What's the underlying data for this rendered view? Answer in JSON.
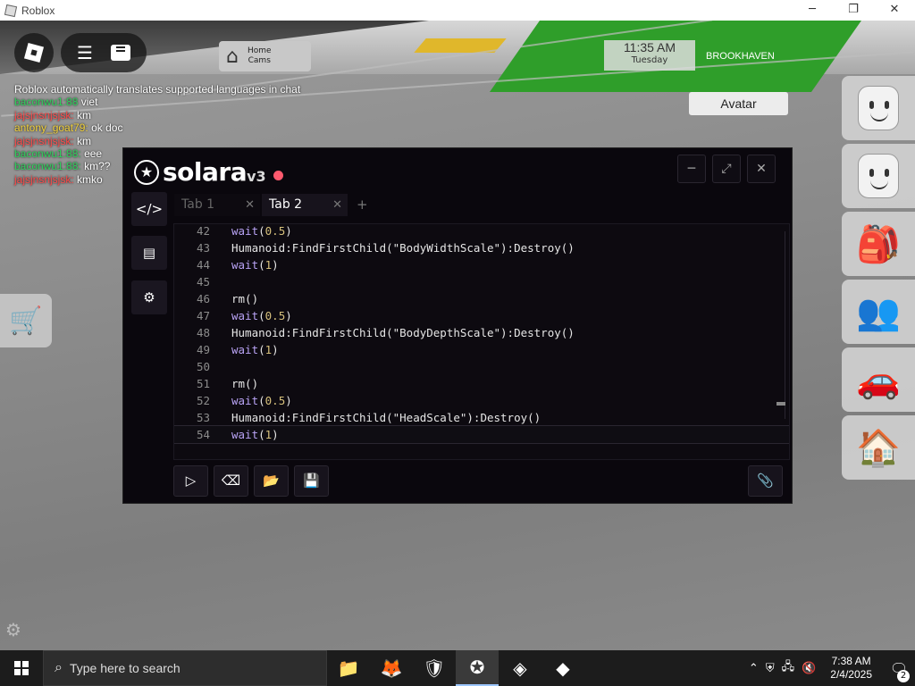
{
  "window": {
    "title": "Roblox",
    "minimize": "─",
    "maximize": "❐",
    "close": "✕"
  },
  "hud": {
    "home_cams_line1": "Home",
    "home_cams_line2": "Cams",
    "clock_time": "11:35 AM",
    "clock_day": "Tuesday",
    "place": "BROOKHAVEN",
    "avatar_label": "Avatar"
  },
  "chat": {
    "system": "Roblox automatically translates supported languages in chat",
    "messages": [
      {
        "name": "baconwu1:88",
        "text": " viet",
        "color": "#2fd15c"
      },
      {
        "name": "jajsjnsnjsjsk:",
        "text": " km",
        "color": "#ff4b4b"
      },
      {
        "name": "antony_goat79:",
        "text": " ok doc",
        "color": "#f2d13a"
      },
      {
        "name": "jajsjnsnjsjsk:",
        "text": " km",
        "color": "#ff4b4b"
      },
      {
        "name": "baconwu1:88:",
        "text": " eee",
        "color": "#2fd15c"
      },
      {
        "name": "baconwu1:88:",
        "text": " km??",
        "color": "#2fd15c"
      },
      {
        "name": "jajsjnsnjsjsk:",
        "text": " kmko",
        "color": "#ff4b4b"
      }
    ]
  },
  "solara": {
    "brand_name": "solara",
    "brand_version": "v3",
    "tabs": [
      {
        "label": "Tab 1"
      },
      {
        "label": "Tab 2"
      }
    ],
    "tab_add": "+",
    "tab_close": "✕",
    "controls": {
      "minimize": "─",
      "expand": "⤢",
      "close": "✕"
    },
    "code_lines": [
      {
        "n": "42",
        "parts": [
          [
            "kw",
            "wait"
          ],
          [
            "p",
            "("
          ],
          [
            "num",
            "0.5"
          ],
          [
            "p",
            ")"
          ]
        ]
      },
      {
        "n": "43",
        "parts": [
          [
            "p",
            "Humanoid:FindFirstChild(\"BodyWidthScale\"):Destroy()"
          ]
        ]
      },
      {
        "n": "44",
        "parts": [
          [
            "kw",
            "wait"
          ],
          [
            "p",
            "("
          ],
          [
            "num",
            "1"
          ],
          [
            "p",
            ")"
          ]
        ]
      },
      {
        "n": "45",
        "parts": []
      },
      {
        "n": "46",
        "parts": [
          [
            "p",
            "rm()"
          ]
        ]
      },
      {
        "n": "47",
        "parts": [
          [
            "kw",
            "wait"
          ],
          [
            "p",
            "("
          ],
          [
            "num",
            "0.5"
          ],
          [
            "p",
            ")"
          ]
        ]
      },
      {
        "n": "48",
        "parts": [
          [
            "p",
            "Humanoid:FindFirstChild(\"BodyDepthScale\"):Destroy()"
          ]
        ]
      },
      {
        "n": "49",
        "parts": [
          [
            "kw",
            "wait"
          ],
          [
            "p",
            "("
          ],
          [
            "num",
            "1"
          ],
          [
            "p",
            ")"
          ]
        ]
      },
      {
        "n": "50",
        "parts": []
      },
      {
        "n": "51",
        "parts": [
          [
            "p",
            "rm()"
          ]
        ]
      },
      {
        "n": "52",
        "parts": [
          [
            "kw",
            "wait"
          ],
          [
            "p",
            "("
          ],
          [
            "num",
            "0.5"
          ],
          [
            "p",
            ")"
          ]
        ]
      },
      {
        "n": "53",
        "parts": [
          [
            "p",
            "Humanoid:FindFirstChild(\"HeadScale\"):Destroy()"
          ]
        ]
      },
      {
        "n": "54",
        "parts": [
          [
            "kw",
            "wait"
          ],
          [
            "p",
            "("
          ],
          [
            "num",
            "1"
          ],
          [
            "p",
            ")"
          ]
        ]
      }
    ]
  },
  "taskbar": {
    "search_placeholder": "Type here to search",
    "time": "7:38 AM",
    "date": "2/4/2025",
    "notification_count": "2"
  }
}
